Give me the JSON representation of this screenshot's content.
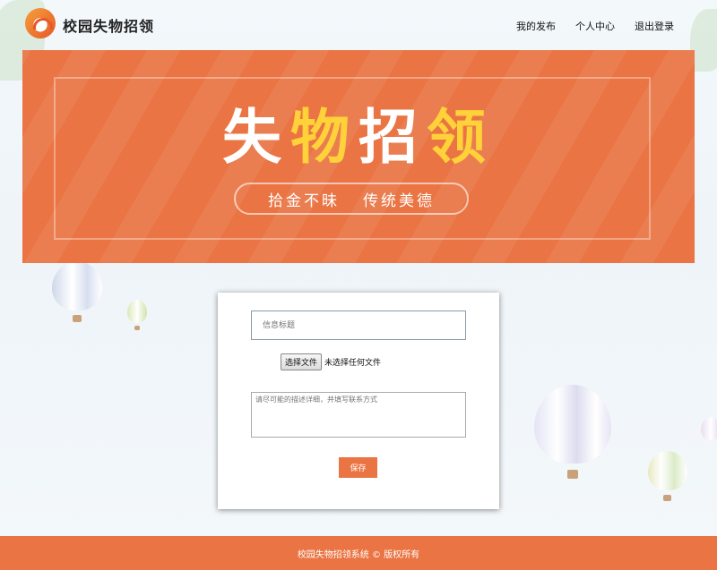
{
  "header": {
    "site_title": "校园失物招领",
    "logo_icon": "lost-found-logo-icon",
    "nav": [
      {
        "label": "我的发布"
      },
      {
        "label": "个人中心"
      },
      {
        "label": "退出登录"
      }
    ]
  },
  "banner": {
    "title_chars": [
      "失",
      "物",
      "招",
      "领"
    ],
    "slogan_left": "拾金不昧",
    "slogan_right": "传统美德",
    "bg_color": "#ea7443",
    "accent_color": "#ffd23a"
  },
  "form": {
    "title_placeholder": "信息标题",
    "file_button": "选择文件",
    "file_status": "未选择任何文件",
    "desc_placeholder": "请尽可能的描述详细，并填写联系方式",
    "save_label": "保存"
  },
  "footer": {
    "text": "校园失物招领系统 © 版权所有"
  }
}
